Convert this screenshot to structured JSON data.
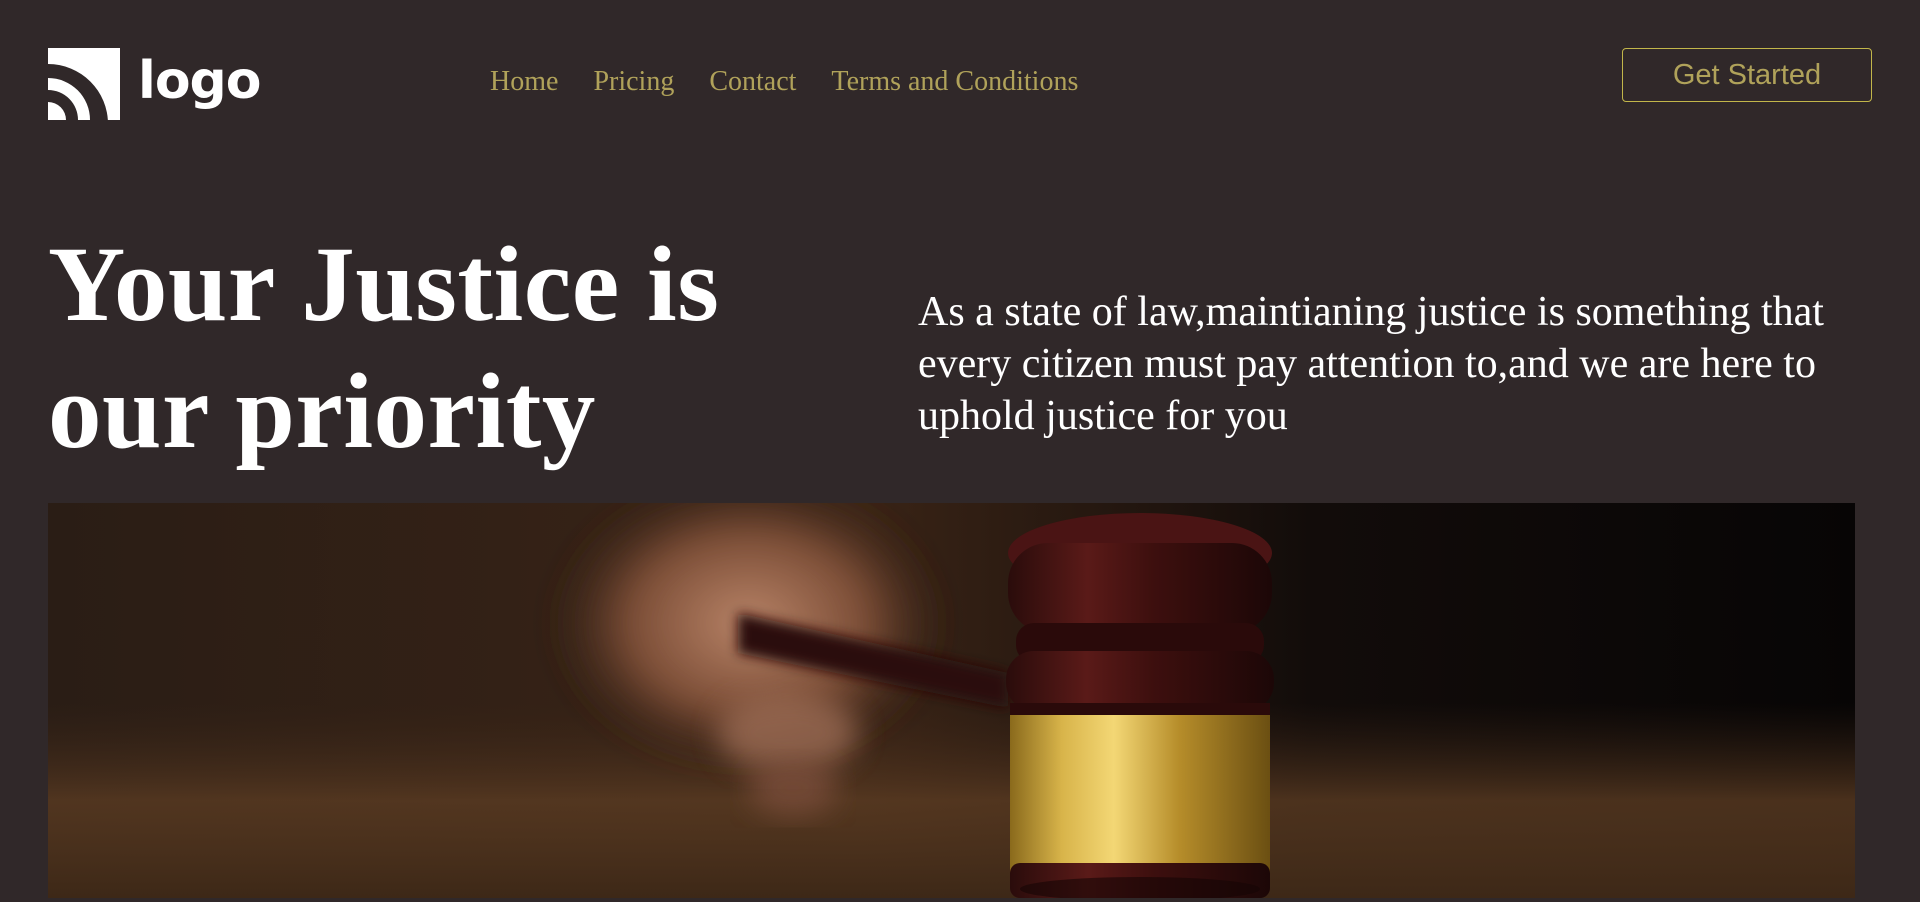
{
  "header": {
    "logo": {
      "text": "logo",
      "icon": "logo-arcs-icon"
    },
    "nav": [
      "Home",
      "Pricing",
      "Contact",
      "Terms and Conditions"
    ],
    "cta_label": "Get Started"
  },
  "hero": {
    "title_line1": "Your Justice is",
    "title_line2": "our priority",
    "description": "As a state of law,maintianing justice is something that every citizen must pay attention to,and we are here to uphold justice for you",
    "image": {
      "subject": "judge-gavel-photo"
    }
  },
  "colors": {
    "background": "#302829",
    "accent": "#b0a25a",
    "cta_border": "#c2b64a",
    "text": "#ffffff"
  }
}
